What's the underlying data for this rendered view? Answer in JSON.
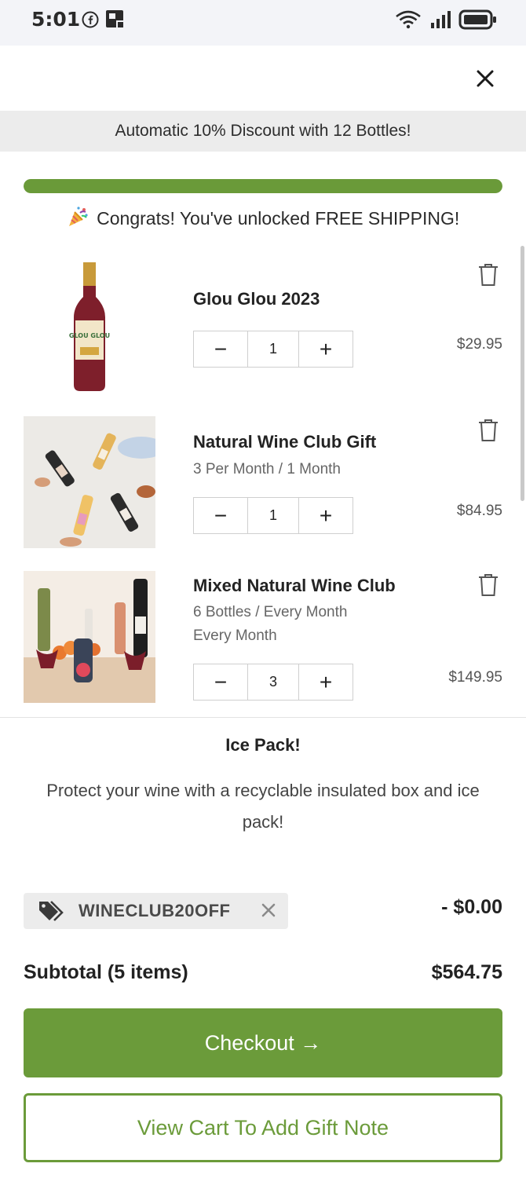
{
  "status_bar": {
    "time": "5:01"
  },
  "banner": {
    "text": "Automatic 10% Discount with 12 Bottles!"
  },
  "shipping_progress": {
    "fraction": 1.0,
    "congrats_prefix": "Congrats! You've unlocked",
    "congrats_highlight": "FREE SHIPPING!"
  },
  "items": [
    {
      "title": "Glou Glou 2023",
      "subtitle": "",
      "subtitle2": "",
      "quantity": "1",
      "price": "$29.95",
      "label_art": "GLOU GLOU"
    },
    {
      "title": "Natural Wine Club Gift",
      "subtitle": "3 Per Month / 1 Month",
      "subtitle2": "",
      "quantity": "1",
      "price": "$84.95"
    },
    {
      "title": "Mixed Natural Wine Club",
      "subtitle": "6 Bottles / Every Month",
      "subtitle2": "Every Month",
      "quantity": "3",
      "price": "$149.95"
    }
  ],
  "stepper": {
    "minus": "−",
    "plus": "+"
  },
  "ice_pack": {
    "title": "Ice Pack!",
    "description": "Protect your wine with a recyclable insulated box and ice pack!"
  },
  "coupon": {
    "code": "WINECLUB20OFF",
    "discount": "- $0.00"
  },
  "subtotal": {
    "label": "Subtotal (5 items)",
    "value": "$564.75"
  },
  "buttons": {
    "checkout": "Checkout →",
    "view_cart": "View Cart To Add Gift Note"
  },
  "colors": {
    "accent_green": "#6b9b3a",
    "banner_bg": "#ececec"
  },
  "icons": [
    "facebook-icon",
    "news-icon",
    "wifi-icon",
    "signal-icon",
    "battery-icon",
    "close-icon",
    "party-popper-icon",
    "trash-icon",
    "tag-icon",
    "remove-coupon-icon"
  ]
}
